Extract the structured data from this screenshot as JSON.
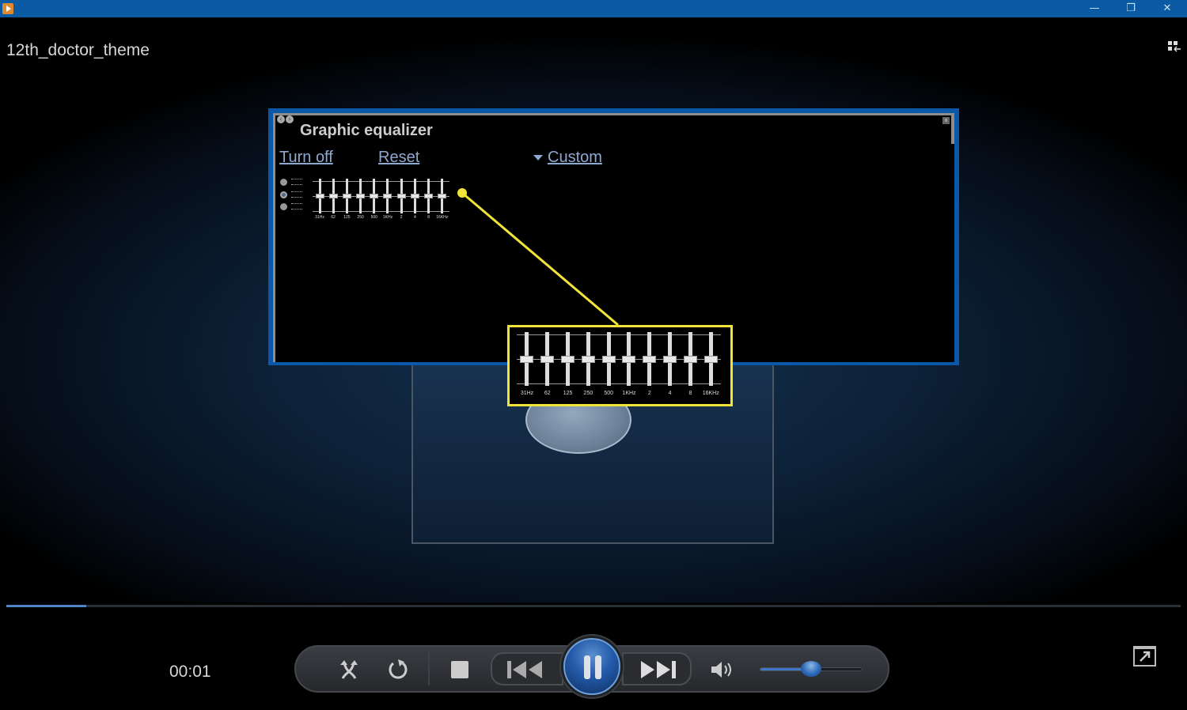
{
  "titlebar": {
    "app_icon": "media-player-icon",
    "minimize": "—",
    "maximize": "❐",
    "close": "✕"
  },
  "video": {
    "now_playing": "12th_doctor_theme",
    "switch_view_icon": "switch-to-library-icon"
  },
  "equalizer": {
    "title": "Graphic equalizer",
    "nav_prev": "‹",
    "nav_next": "›",
    "close": "x",
    "turn_off": "Turn off",
    "reset": "Reset",
    "preset": "Custom",
    "modes": [
      {
        "name": "slider-mode-independent",
        "selected": false
      },
      {
        "name": "slider-mode-loose",
        "selected": true
      },
      {
        "name": "slider-mode-tight",
        "selected": false
      }
    ],
    "bands": [
      {
        "label": "31Hz",
        "level": 0
      },
      {
        "label": "62",
        "level": 0
      },
      {
        "label": "125",
        "level": 0
      },
      {
        "label": "250",
        "level": 0
      },
      {
        "label": "500",
        "level": 0
      },
      {
        "label": "1KHz",
        "level": 0
      },
      {
        "label": "2",
        "level": 0
      },
      {
        "label": "4",
        "level": 0
      },
      {
        "label": "8",
        "level": 0
      },
      {
        "label": "16KHz",
        "level": 0
      }
    ],
    "callout_color": "#f2e33a"
  },
  "playback": {
    "elapsed": "00:01",
    "progress_fraction": 0.068,
    "volume_fraction": 0.5,
    "state": "playing"
  },
  "controls": {
    "shuffle": "shuffle-icon",
    "repeat": "repeat-icon",
    "stop": "stop-icon",
    "previous": "previous-icon",
    "pause": "pause-icon",
    "next": "next-icon",
    "mute": "volume-icon",
    "fullscreen": "fullscreen-icon"
  },
  "colors": {
    "titlebar": "#0a5aa4",
    "accent": "#235aa8",
    "link": "#8ea9cf"
  }
}
